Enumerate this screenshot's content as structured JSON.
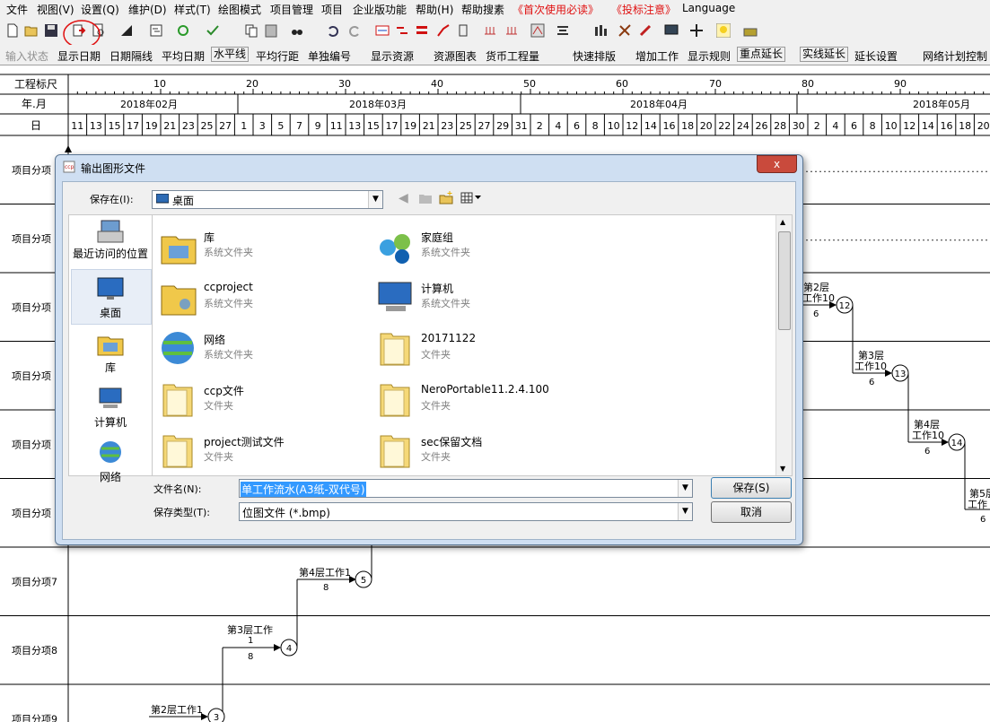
{
  "menu": [
    "文件",
    "视图(V)",
    "设置(Q)",
    "维护(D)",
    "样式(T)",
    "绘图模式",
    "项目管理",
    "项目",
    "企业版功能",
    "帮助(H)",
    "帮助搜素",
    "《首次使用必读》",
    "《投标注意》",
    "Language"
  ],
  "toolbar2": {
    "input_state": "输入状态",
    "show_date": "显示日期",
    "date_gap": "日期隔线",
    "avg_date": "平均日期",
    "hline": "水平线",
    "avg_row": "平均行距",
    "single_number": "单独编号",
    "show_resource": "显示资源",
    "resource_chart": "资源图表",
    "currency_qty": "货币工程量",
    "quick_schedule": "快速排版",
    "add_work": "增加工作",
    "show_rules": "显示规则",
    "key_extend": "重点延长",
    "solid_extend": "实线延长",
    "extend_settings": "延长设置",
    "network_control": "网络计划控制"
  },
  "grid": {
    "row_ruler": "工程标尺",
    "row_month": "年.月",
    "row_day": "日",
    "ruler_ticks": [
      "10",
      "20",
      "30",
      "40",
      "50",
      "60",
      "70",
      "80",
      "90"
    ],
    "months": [
      "2018年02月",
      "2018年03月",
      "2018年04月",
      "2018年05月"
    ],
    "days": [
      "11",
      "13",
      "15",
      "17",
      "19",
      "21",
      "23",
      "25",
      "27",
      "1",
      "3",
      "5",
      "7",
      "9",
      "11",
      "13",
      "15",
      "17",
      "19",
      "21",
      "23",
      "25",
      "27",
      "29",
      "31",
      "2",
      "4",
      "6",
      "8",
      "10",
      "12",
      "14",
      "16",
      "18",
      "20",
      "22",
      "24",
      "26",
      "28",
      "30",
      "2",
      "4",
      "6",
      "8",
      "10",
      "12",
      "14",
      "16",
      "18",
      "20"
    ],
    "rows": [
      "项目分项",
      "项目分项",
      "项目分项",
      "项目分项",
      "项目分项",
      "项目分项",
      "项目分项7",
      "项目分项8",
      "项目分项9"
    ],
    "tasks": [
      {
        "name": "第2层",
        "work": "工作10",
        "dur": "6",
        "node": "12"
      },
      {
        "name": "第3层",
        "work": "工作10",
        "dur": "6",
        "node": "13"
      },
      {
        "name": "第4层",
        "work": "工作10",
        "dur": "6",
        "node": "14"
      },
      {
        "name": "第5层",
        "work": "工作",
        "dur": "6",
        "node": ""
      },
      {
        "name": "第4层工作1",
        "work": "",
        "dur": "8",
        "node": "5"
      },
      {
        "name": "第3层工作",
        "work": "1",
        "dur": "8",
        "node": "4"
      },
      {
        "name": "第2层工作1",
        "work": "",
        "dur": "",
        "node": "3"
      }
    ]
  },
  "dialog": {
    "title": "输出图形文件",
    "close": "x",
    "save_in_label": "保存在(I):",
    "save_in_value": "桌面",
    "places": [
      "最近访问的位置",
      "桌面",
      "库",
      "计算机",
      "网络"
    ],
    "items": [
      {
        "name": "库",
        "type": "系统文件夹",
        "icon": "library-icon"
      },
      {
        "name": "家庭组",
        "type": "系统文件夹",
        "icon": "homegroup-icon"
      },
      {
        "name": "ccproject",
        "type": "系统文件夹",
        "icon": "user-folder-icon"
      },
      {
        "name": "计算机",
        "type": "系统文件夹",
        "icon": "computer-icon"
      },
      {
        "name": "网络",
        "type": "系统文件夹",
        "icon": "network-icon"
      },
      {
        "name": "20171122",
        "type": "文件夹",
        "icon": "folder-icon"
      },
      {
        "name": "ccp文件",
        "type": "文件夹",
        "icon": "folder-icon"
      },
      {
        "name": "NeroPortable11.2.4.100",
        "type": "文件夹",
        "icon": "folder-icon"
      },
      {
        "name": "project测试文件",
        "type": "文件夹",
        "icon": "folder-icon"
      },
      {
        "name": "sec保留文档",
        "type": "文件夹",
        "icon": "folder-icon"
      }
    ],
    "filename_label": "文件名(N):",
    "filename_value": "单工作流水(A3纸-双代号)",
    "filetype_label": "保存类型(T):",
    "filetype_value": "位图文件 (*.bmp)",
    "save_button": "保存(S)",
    "cancel_button": "取消"
  }
}
